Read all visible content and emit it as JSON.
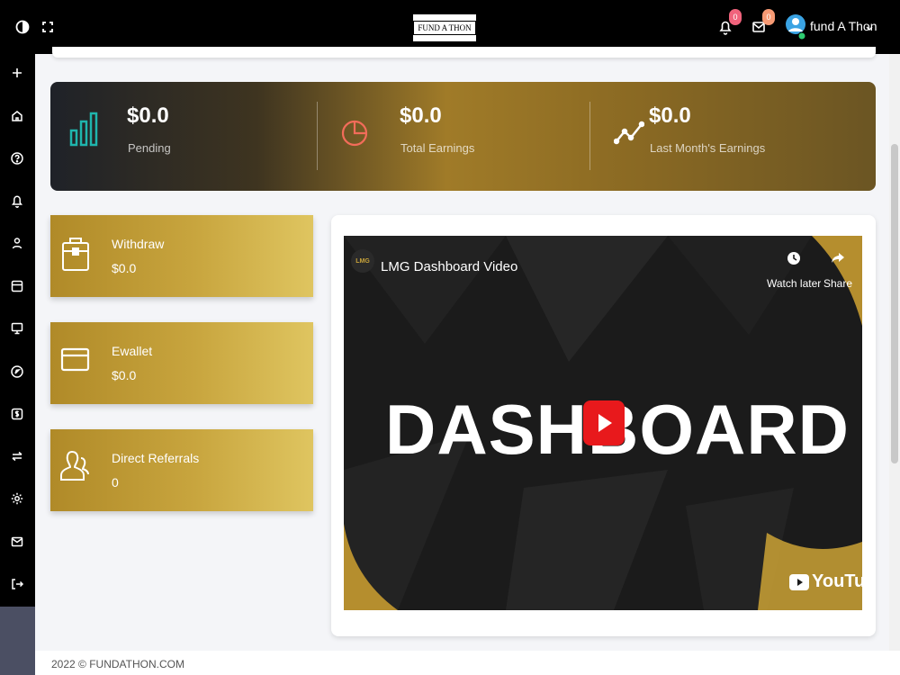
{
  "header": {
    "logo_text": "FUND A THON",
    "notifications_count": "0",
    "messages_count": "0",
    "username": "fund A Thon",
    "icons": [
      "toggle-icon",
      "fullscreen-icon",
      "bell-icon",
      "mail-icon",
      "avatar-icon",
      "chevron-down-icon"
    ]
  },
  "sidebar": {
    "items": [
      {
        "icon": "plus-icon"
      },
      {
        "icon": "home-icon"
      },
      {
        "icon": "help-icon"
      },
      {
        "icon": "bell-icon"
      },
      {
        "icon": "user-icon"
      },
      {
        "icon": "layout-icon"
      },
      {
        "icon": "monitor-icon"
      },
      {
        "icon": "compass-icon"
      },
      {
        "icon": "money-icon"
      },
      {
        "icon": "transfer-icon"
      },
      {
        "icon": "settings-icon"
      },
      {
        "icon": "mail-icon"
      },
      {
        "icon": "logout-icon"
      }
    ]
  },
  "stats": [
    {
      "value": "$0.0",
      "label": "Pending",
      "icon": "bar-chart-icon"
    },
    {
      "value": "$0.0",
      "label": "Total Earnings",
      "icon": "pie-chart-icon"
    },
    {
      "value": "$0.0",
      "label": "Last Month's Earnings",
      "icon": "trend-line-icon"
    }
  ],
  "cards": [
    {
      "title": "Withdraw",
      "value": "$0.0",
      "icon": "briefcase-icon"
    },
    {
      "title": "Ewallet",
      "value": "$0.0",
      "icon": "credit-card-icon"
    },
    {
      "title": "Direct Referrals",
      "value": "0",
      "icon": "users-icon"
    }
  ],
  "video": {
    "channel_logo": "LMG",
    "title": "LMG Dashboard Video",
    "watch_later_label": "Watch later",
    "share_label": "Share",
    "thumbnail_text": "DASHBOARD",
    "brand": "YouTube"
  },
  "footer": {
    "text": "2022 © FUNDATHON.COM"
  },
  "colors": {
    "topbar": "#000000",
    "accent_gold": "#c8a53e",
    "stats_gradient_dark": "#1f2228",
    "stats_gradient_gold": "#a07b28",
    "badge_notifications": "#f0637c",
    "badge_messages": "#f79a74",
    "youtube_red": "#e8191c"
  }
}
